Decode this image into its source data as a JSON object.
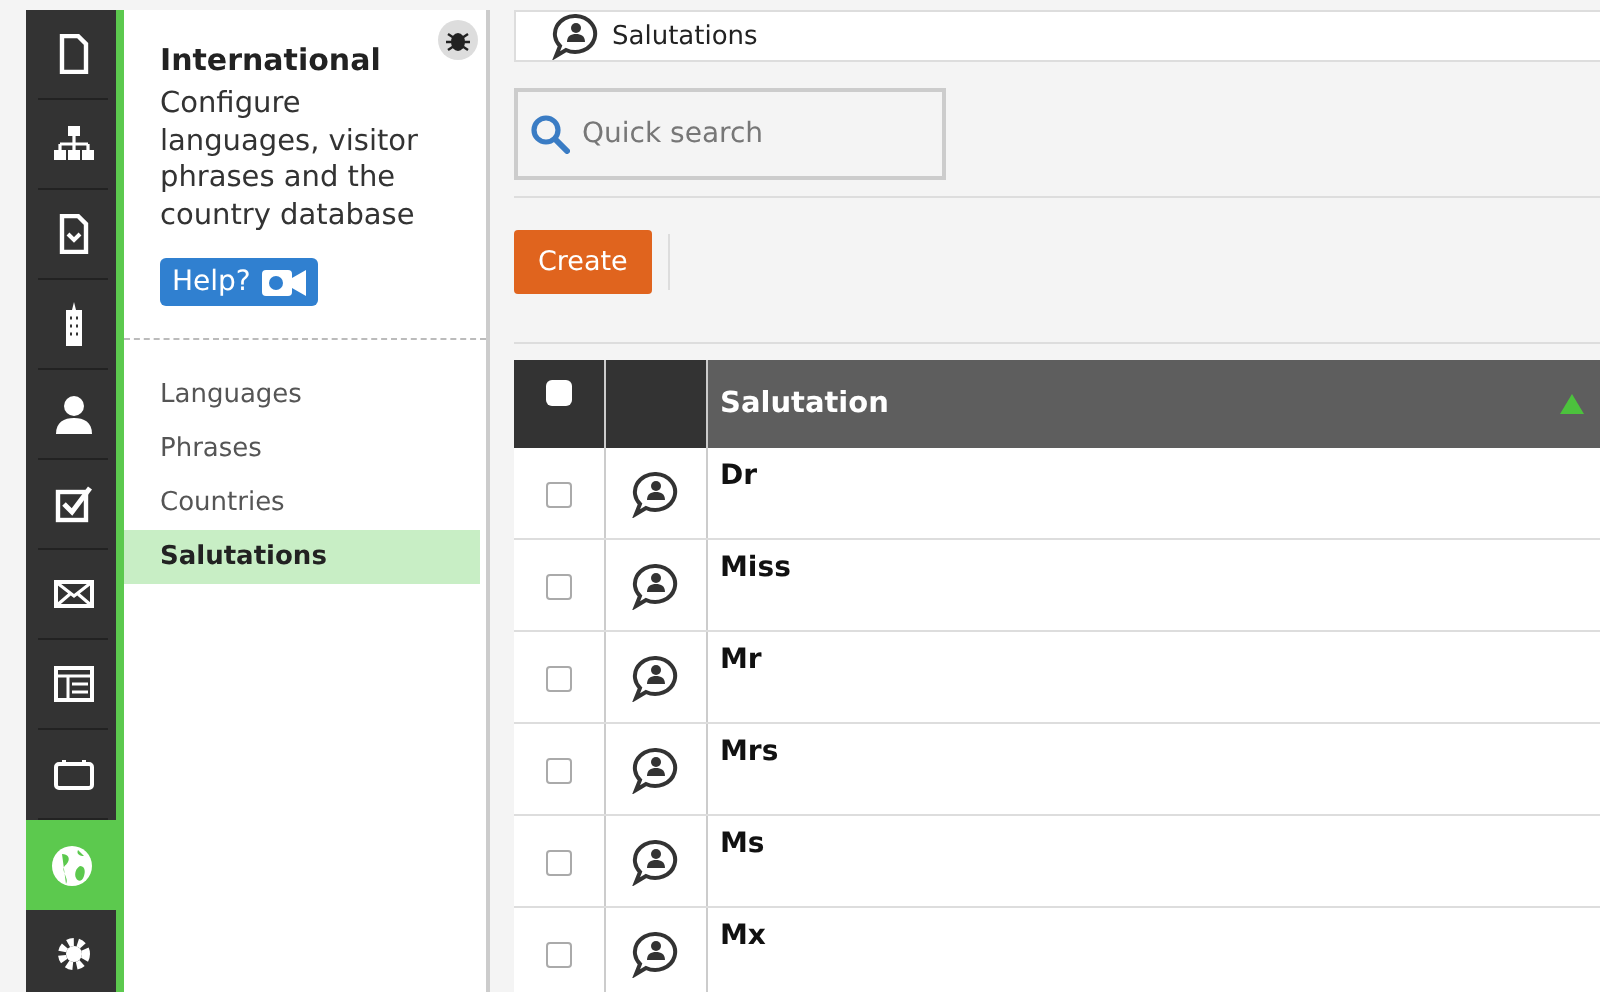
{
  "rail": [
    {
      "kind": "page",
      "selected": false
    },
    {
      "kind": "tree",
      "selected": false
    },
    {
      "kind": "doc",
      "selected": false
    },
    {
      "kind": "building",
      "selected": false
    },
    {
      "kind": "person",
      "selected": false
    },
    {
      "kind": "check",
      "selected": false
    },
    {
      "kind": "mail",
      "selected": false
    },
    {
      "kind": "layout",
      "selected": false
    },
    {
      "kind": "box",
      "selected": false
    },
    {
      "kind": "globe",
      "selected": true
    },
    {
      "kind": "gear",
      "selected": false
    }
  ],
  "panel": {
    "title": "International",
    "description": "Configure languages, visitor phrases and the country database",
    "help_button": "Help?",
    "items": [
      {
        "label": "Languages",
        "selected": false
      },
      {
        "label": "Phrases",
        "selected": false
      },
      {
        "label": "Countries",
        "selected": false
      },
      {
        "label": "Salutations",
        "selected": true
      }
    ]
  },
  "header": {
    "title": "Salutations"
  },
  "search": {
    "placeholder": "Quick search"
  },
  "create_button": "Create",
  "table": {
    "header_checked": false,
    "columns": [
      "Salutation"
    ],
    "rows": [
      {
        "checked": false,
        "salutation": "Dr"
      },
      {
        "checked": false,
        "salutation": "Miss"
      },
      {
        "checked": false,
        "salutation": "Mr"
      },
      {
        "checked": false,
        "salutation": "Mrs"
      },
      {
        "checked": false,
        "salutation": "Ms"
      },
      {
        "checked": false,
        "salutation": "Mx"
      }
    ]
  }
}
